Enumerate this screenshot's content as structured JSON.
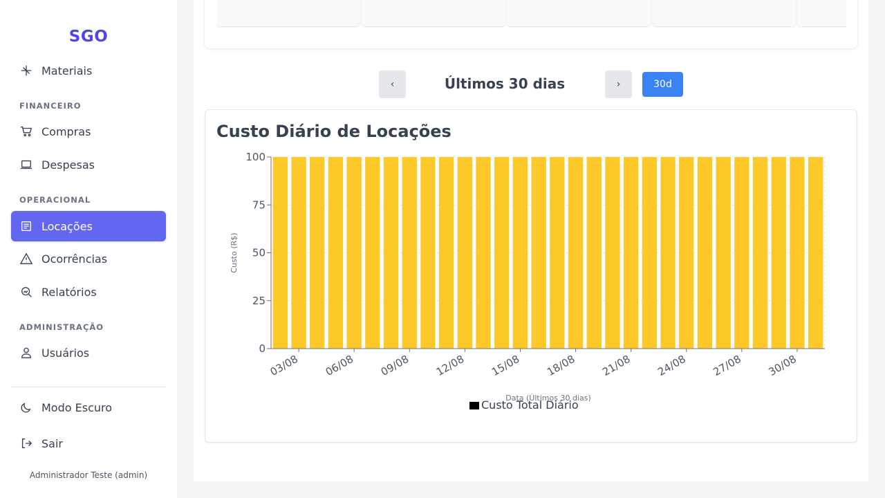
{
  "sidebar": {
    "brand": "SGO",
    "partial_item": "Materiais",
    "sections": {
      "financeiro": "FINANCEIRO",
      "operacional": "OPERACIONAL",
      "administracao": "ADMINISTRAÇÃO"
    },
    "items": {
      "compras": "Compras",
      "despesas": "Despesas",
      "locacoes": "Locações",
      "ocorrencias": "Ocorrências",
      "relatorios": "Relatórios",
      "usuarios": "Usuários"
    },
    "dark_mode": "Modo Escuro",
    "logout": "Sair",
    "user": "Administrador Teste (admin)"
  },
  "controls": {
    "prev": "‹",
    "next": "›",
    "period_title": "Últimos 30 dias",
    "range": "30d"
  },
  "colors": {
    "accent": "#6366f1",
    "brand": "#4f46e5",
    "range_button": "#3b82f6",
    "bar": "#fcc928"
  },
  "chart_data": {
    "type": "bar",
    "title": "Custo Diário de Locações",
    "xlabel": "Data (Últimos 30 dias)",
    "ylabel": "Custo (R$)",
    "ylim": [
      0,
      100
    ],
    "yticks": [
      "0",
      "25",
      "50",
      "75",
      "100"
    ],
    "categories": [
      "02/08",
      "03/08",
      "04/08",
      "05/08",
      "06/08",
      "07/08",
      "08/08",
      "09/08",
      "10/08",
      "11/08",
      "12/08",
      "13/08",
      "14/08",
      "15/08",
      "16/08",
      "17/08",
      "18/08",
      "19/08",
      "20/08",
      "21/08",
      "22/08",
      "23/08",
      "24/08",
      "25/08",
      "26/08",
      "27/08",
      "28/08",
      "29/08",
      "30/08",
      "31/08"
    ],
    "tick_labels": [
      "03/08",
      "06/08",
      "09/08",
      "12/08",
      "15/08",
      "18/08",
      "21/08",
      "24/08",
      "27/08",
      "30/08"
    ],
    "series": [
      {
        "name": "Custo Total Diário",
        "values": [
          100,
          100,
          100,
          100,
          100,
          100,
          100,
          100,
          100,
          100,
          100,
          100,
          100,
          100,
          100,
          100,
          100,
          100,
          100,
          100,
          100,
          100,
          100,
          100,
          100,
          100,
          100,
          100,
          100,
          100
        ]
      }
    ],
    "legend": "bottom",
    "grid": true
  }
}
